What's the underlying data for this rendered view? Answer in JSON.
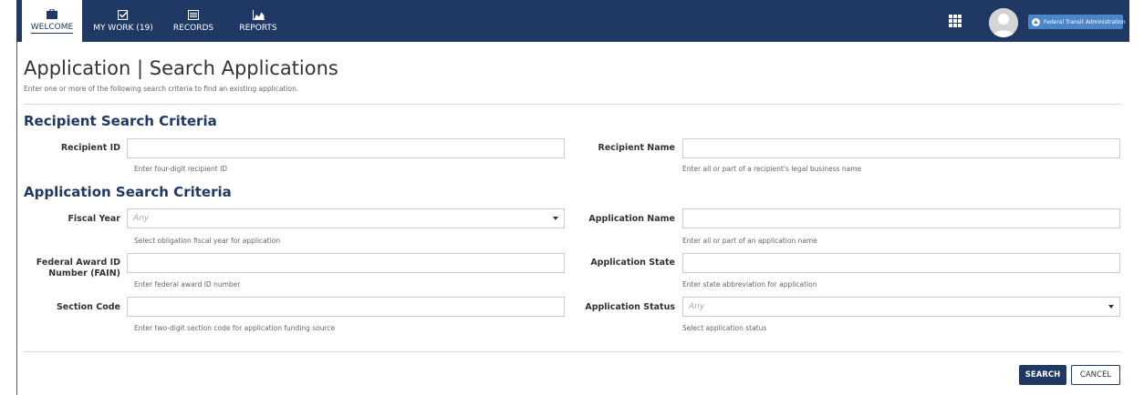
{
  "nav": {
    "items": [
      {
        "label": "WELCOME",
        "icon": "briefcase-icon",
        "active": true
      },
      {
        "label": "MY WORK (19)",
        "icon": "checkbox-icon",
        "active": false
      },
      {
        "label": "RECORDS",
        "icon": "records-icon",
        "active": false
      },
      {
        "label": "REPORTS",
        "icon": "chart-icon",
        "active": false
      }
    ],
    "agency": "Federal Transit Administration"
  },
  "page": {
    "title": "Application | Search Applications",
    "subtitle": "Enter one or more of the following search criteria to find an existing application."
  },
  "recipient": {
    "heading": "Recipient Search Criteria",
    "id_label": "Recipient ID",
    "id_value": "",
    "id_help": "Enter four-digit recipient ID",
    "name_label": "Recipient Name",
    "name_value": "",
    "name_help": "Enter all or part of a recipient's legal business name"
  },
  "application": {
    "heading": "Application Search Criteria",
    "fiscal_year_label": "Fiscal Year",
    "fiscal_year_value": "Any",
    "fiscal_year_help": "Select obligation fiscal year for application",
    "app_name_label": "Application Name",
    "app_name_value": "",
    "app_name_help": "Enter all or part of an application name",
    "fain_label": "Federal Award ID Number (FAIN)",
    "fain_value": "",
    "fain_help": "Enter federal award ID number",
    "state_label": "Application State",
    "state_value": "",
    "state_help": "Enter state abbreviation for application",
    "section_label": "Section Code",
    "section_value": "",
    "section_help": "Enter two-digit section code for application funding source",
    "status_label": "Application Status",
    "status_value": "Any",
    "status_help": "Select application status"
  },
  "actions": {
    "search_label": "SEARCH",
    "cancel_label": "CANCEL"
  },
  "colors": {
    "nav_bg": "#1f3864",
    "heading": "#1f3864",
    "agency_badge": "#4a86c8"
  }
}
